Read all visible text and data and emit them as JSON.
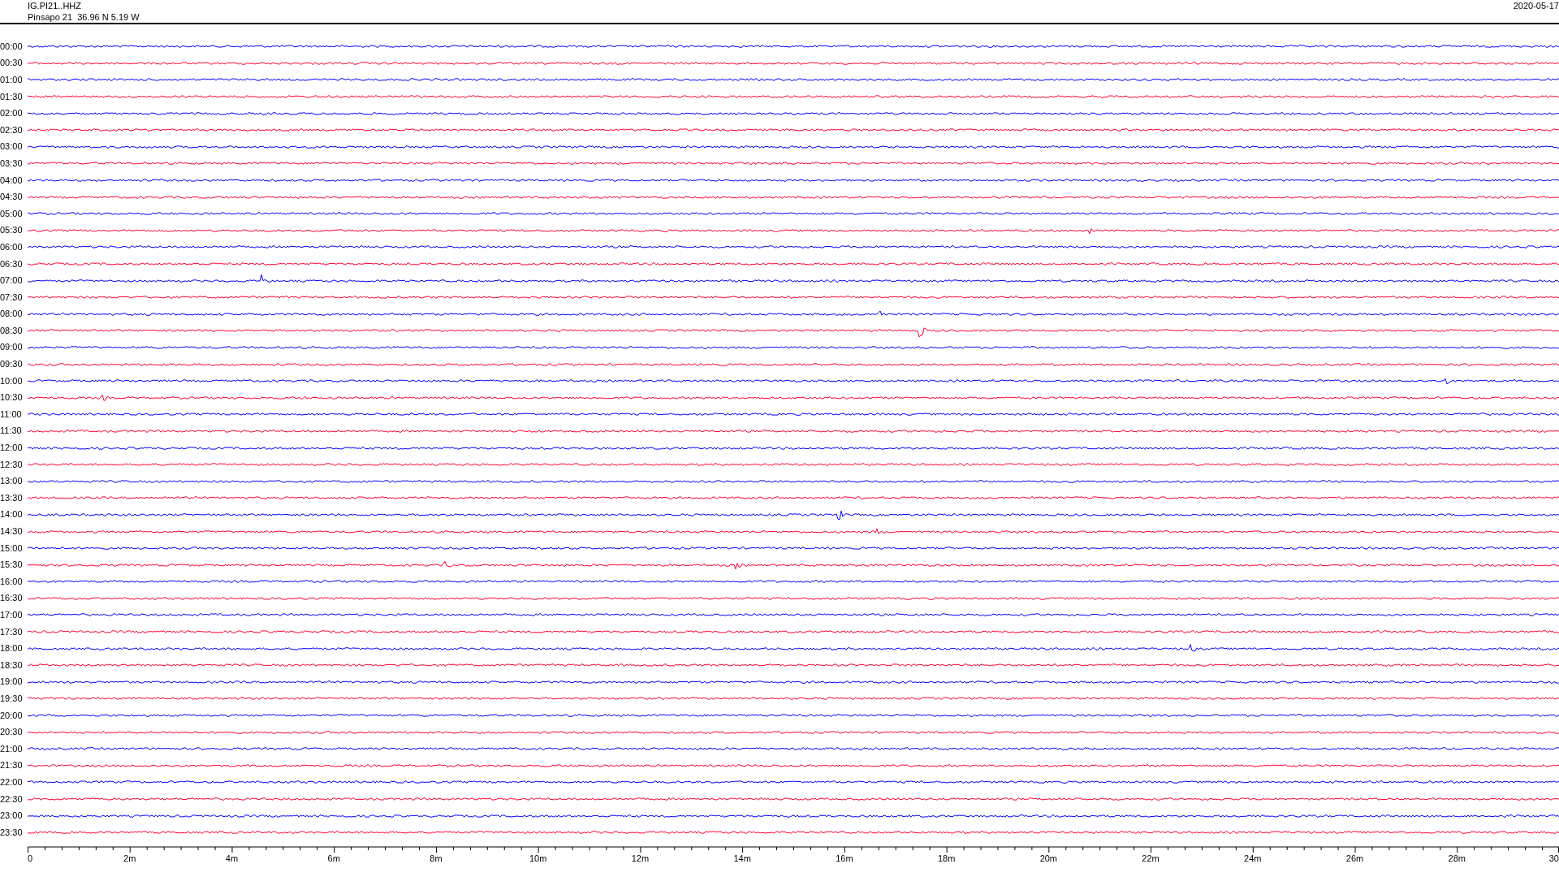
{
  "header": {
    "station": "IG.PI21..HHZ",
    "location": "Pinsapo 21  36.96 N 5.19 W",
    "date": "2020-05-17"
  },
  "traces": [
    {
      "label": "00:00",
      "color": "#0000ff"
    },
    {
      "label": "00:30",
      "color": "#ff0033"
    },
    {
      "label": "01:00",
      "color": "#0000ff"
    },
    {
      "label": "01:30",
      "color": "#ff0033"
    },
    {
      "label": "02:00",
      "color": "#0000ff"
    },
    {
      "label": "02:30",
      "color": "#ff0033"
    },
    {
      "label": "03:00",
      "color": "#0000ff"
    },
    {
      "label": "03:30",
      "color": "#ff0033"
    },
    {
      "label": "04:00",
      "color": "#0000ff"
    },
    {
      "label": "04:30",
      "color": "#ff0033"
    },
    {
      "label": "05:00",
      "color": "#0000ff"
    },
    {
      "label": "05:30",
      "color": "#ff0033"
    },
    {
      "label": "06:00",
      "color": "#0000ff"
    },
    {
      "label": "06:30",
      "color": "#ff0033"
    },
    {
      "label": "07:00",
      "color": "#0000ff"
    },
    {
      "label": "07:30",
      "color": "#ff0033"
    },
    {
      "label": "08:00",
      "color": "#0000ff"
    },
    {
      "label": "08:30",
      "color": "#ff0033"
    },
    {
      "label": "09:00",
      "color": "#0000ff"
    },
    {
      "label": "09:30",
      "color": "#ff0033"
    },
    {
      "label": "10:00",
      "color": "#0000ff"
    },
    {
      "label": "10:30",
      "color": "#ff0033"
    },
    {
      "label": "11:00",
      "color": "#0000ff"
    },
    {
      "label": "11:30",
      "color": "#ff0033"
    },
    {
      "label": "12:00",
      "color": "#0000ff"
    },
    {
      "label": "12:30",
      "color": "#ff0033"
    },
    {
      "label": "13:00",
      "color": "#0000ff"
    },
    {
      "label": "13:30",
      "color": "#ff0033"
    },
    {
      "label": "14:00",
      "color": "#0000ff"
    },
    {
      "label": "14:30",
      "color": "#ff0033"
    },
    {
      "label": "15:00",
      "color": "#0000ff"
    },
    {
      "label": "15:30",
      "color": "#ff0033"
    },
    {
      "label": "16:00",
      "color": "#0000ff"
    },
    {
      "label": "16:30",
      "color": "#ff0033"
    },
    {
      "label": "17:00",
      "color": "#0000ff"
    },
    {
      "label": "17:30",
      "color": "#ff0033"
    },
    {
      "label": "18:00",
      "color": "#0000ff"
    },
    {
      "label": "18:30",
      "color": "#ff0033"
    },
    {
      "label": "19:00",
      "color": "#0000ff"
    },
    {
      "label": "19:30",
      "color": "#ff0033"
    },
    {
      "label": "20:00",
      "color": "#0000ff"
    },
    {
      "label": "20:30",
      "color": "#ff0033"
    },
    {
      "label": "21:00",
      "color": "#0000ff"
    },
    {
      "label": "21:30",
      "color": "#ff0033"
    },
    {
      "label": "22:00",
      "color": "#0000ff"
    },
    {
      "label": "22:30",
      "color": "#ff0033"
    },
    {
      "label": "23:00",
      "color": "#0000ff"
    },
    {
      "label": "23:30",
      "color": "#ff0033"
    }
  ],
  "time_axis": {
    "tick_labels": [
      "0",
      "2m",
      "4m",
      "6m",
      "8m",
      "10m",
      "12m",
      "14m",
      "16m",
      "18m",
      "20m",
      "22m",
      "24m",
      "26m",
      "28m",
      "30"
    ]
  }
}
